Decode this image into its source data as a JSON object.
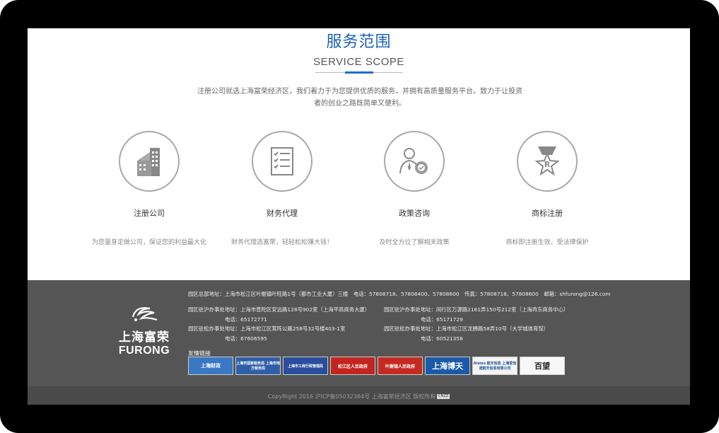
{
  "section": {
    "title_cn": "服务范围",
    "title_en": "SERVICE SCOPE",
    "intro_line1": "注册公司就选上海富荣经济区，我们着力于为您提供优质的服务，并拥有高质量服务平台。致力于让投资",
    "intro_line2": "者的创业之路既简单又便利。"
  },
  "services": [
    {
      "icon": "building-icon",
      "title": "注册公司",
      "desc": "为您量身定做公司，保证您的利益最大化"
    },
    {
      "icon": "checklist-icon",
      "title": "财务代理",
      "desc": "财务代理选富荣，轻轻松松赚大钱！"
    },
    {
      "icon": "consultant-gear-icon",
      "title": "政策咨询",
      "desc": "及时全方位了解相关政策"
    },
    {
      "icon": "trademark-medal-icon",
      "title": "商标注册",
      "desc": "商标即注册生效，受法律保护"
    }
  ],
  "footer": {
    "logo_cn": "上海富荣",
    "logo_en": "FURONG",
    "hq": "园区总部地址：上海市松江区叶榭镇叶旺路1号（都市工业大厦）三楼　电话：57808718、57808400、57808600　传真：57808718、57808600　邮箱：shfurong@126.com",
    "office1": "园区驻沪办事处地址：上海市普陀区安远路128号902室（上海平高商务大厦）",
    "office1_phone": "电话：65172771",
    "office2": "园区驻沪办事处地址：闵行区万源路2161弄150号212室（上海冉东商务中心）",
    "office2_phone": "电话：65171729",
    "office3": "园区驻松办事处地址：上海市松江区茸阵公路258号32号楼403-1室",
    "office3_phone": "电话：67606595",
    "office4": "园区驻松办事处地址：上海市松江区龙腾路58弄10号（大学城体育馆）",
    "office4_phone": "电话：60521358",
    "links_title": "友情链接",
    "links": [
      {
        "label": "上海财政",
        "color": "#3b78c4"
      },
      {
        "label": "上海市国家税务局 上海市地方税务局",
        "color": "#2f5fa8"
      },
      {
        "label": "上海市工商行政管理局",
        "color": "#2a4e9c"
      },
      {
        "label": "松江区人民政府",
        "color": "#c2241f"
      },
      {
        "label": "叶榭镇人民政府",
        "color": "#c42a22"
      },
      {
        "label": "上海博天",
        "color": "#1b5aa8"
      },
      {
        "label": "Aisino 航天信息 上海爱信诺航天信息有限公司",
        "color": "#f4f4f4"
      },
      {
        "label": "百望",
        "color": "#f7f7f7"
      }
    ],
    "copyright": "CopyRight 2016 沪ICP备05032384号 上海富荣经济区 版权所有",
    "badge": "CNZZ"
  }
}
